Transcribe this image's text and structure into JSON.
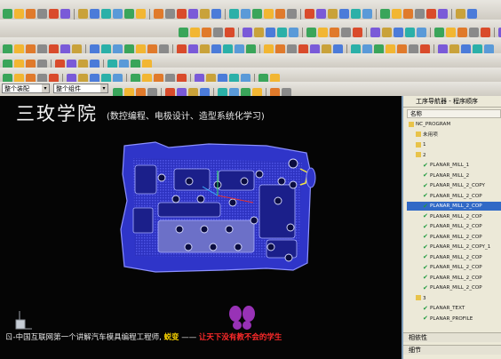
{
  "colors": {
    "viewport_bg": "#050505",
    "part_color": "#3a3fd8",
    "brand_text": "#f2f2f2",
    "highlight_yellow": "#f5d000",
    "slogan_red": "#ff2a2a",
    "selection_blue": "#3169c6"
  },
  "toolbar": {
    "selection_filter": "整个装配",
    "type_filter": "整个组件",
    "icon_names": [
      "point-icon",
      "line-icon",
      "arc-icon",
      "snap-icon",
      "view-icon",
      "layer-icon",
      "operation-icon",
      "tool-icon",
      "geometry-icon",
      "method-icon",
      "generate-icon",
      "verify-icon",
      "postprocess-icon",
      "shop-doc-icon"
    ]
  },
  "viewport": {
    "brand_title": "三玫学院",
    "brand_subtitle": "(数控编程、电极设计、造型系统化学习)",
    "ticker_prefix": "ㄖ-中国互联网第一个讲解汽车模具编程工程师,",
    "ticker_name": "蜕变",
    "ticker_dash": "——",
    "ticker_slogan": "让天下没有教不会的学生"
  },
  "navigator": {
    "title": "工序导航器 - 程序顺序",
    "column_header": "名称",
    "items": [
      {
        "label": "NC_PROGRAM",
        "indent": 0,
        "icon": "folder-icon",
        "selected": false
      },
      {
        "label": "未用项",
        "indent": 1,
        "icon": "folder-icon",
        "selected": false
      },
      {
        "label": "1",
        "indent": 1,
        "icon": "program-icon",
        "selected": false
      },
      {
        "label": "2",
        "indent": 1,
        "icon": "program-icon",
        "selected": false
      },
      {
        "label": "PLANAR_MILL_1",
        "indent": 2,
        "icon": "check-icon",
        "selected": false
      },
      {
        "label": "PLANAR_MILL_2",
        "indent": 2,
        "icon": "check-icon",
        "selected": false
      },
      {
        "label": "PLANAR_MILL_2_COPY",
        "indent": 2,
        "icon": "check-icon",
        "selected": false
      },
      {
        "label": "PLANAR_MILL_2_COP",
        "indent": 2,
        "icon": "check-icon",
        "selected": false
      },
      {
        "label": "PLANAR_MILL_2_COP",
        "indent": 2,
        "icon": "check-icon",
        "selected": true
      },
      {
        "label": "PLANAR_MILL_2_COP",
        "indent": 2,
        "icon": "check-icon",
        "selected": false
      },
      {
        "label": "PLANAR_MILL_2_COP",
        "indent": 2,
        "icon": "check-icon",
        "selected": false
      },
      {
        "label": "PLANAR_MILL_2_COP",
        "indent": 2,
        "icon": "check-icon",
        "selected": false
      },
      {
        "label": "PLANAR_MILL_2_COPY_1",
        "indent": 2,
        "icon": "check-icon",
        "selected": false
      },
      {
        "label": "PLANAR_MILL_2_COP",
        "indent": 2,
        "icon": "check-icon",
        "selected": false
      },
      {
        "label": "PLANAR_MILL_2_COP",
        "indent": 2,
        "icon": "check-icon",
        "selected": false
      },
      {
        "label": "PLANAR_MILL_2_COP",
        "indent": 2,
        "icon": "check-icon",
        "selected": false
      },
      {
        "label": "PLANAR_MILL_2_COP",
        "indent": 2,
        "icon": "check-icon",
        "selected": false
      },
      {
        "label": "3",
        "indent": 1,
        "icon": "program-icon",
        "selected": false
      },
      {
        "label": "PLANAR_TEXT",
        "indent": 2,
        "icon": "check-icon",
        "selected": false
      },
      {
        "label": "PLANAR_PROFILE",
        "indent": 2,
        "icon": "check-icon",
        "selected": false
      }
    ],
    "footer_dependencies": "相依性",
    "footer_details": "细节"
  }
}
